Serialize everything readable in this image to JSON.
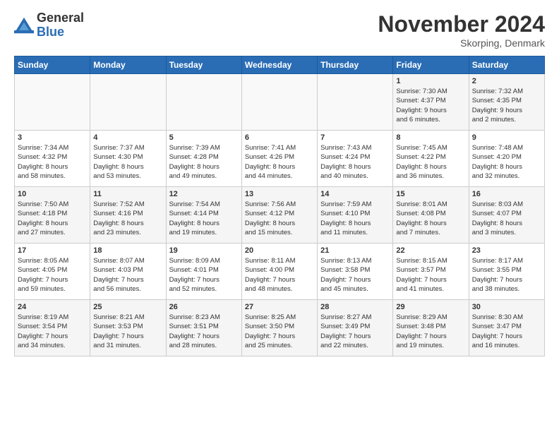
{
  "logo": {
    "line1": "General",
    "line2": "Blue"
  },
  "title": "November 2024",
  "location": "Skorping, Denmark",
  "days_of_week": [
    "Sunday",
    "Monday",
    "Tuesday",
    "Wednesday",
    "Thursday",
    "Friday",
    "Saturday"
  ],
  "weeks": [
    [
      {
        "day": "",
        "info": ""
      },
      {
        "day": "",
        "info": ""
      },
      {
        "day": "",
        "info": ""
      },
      {
        "day": "",
        "info": ""
      },
      {
        "day": "",
        "info": ""
      },
      {
        "day": "1",
        "info": "Sunrise: 7:30 AM\nSunset: 4:37 PM\nDaylight: 9 hours\nand 6 minutes."
      },
      {
        "day": "2",
        "info": "Sunrise: 7:32 AM\nSunset: 4:35 PM\nDaylight: 9 hours\nand 2 minutes."
      }
    ],
    [
      {
        "day": "3",
        "info": "Sunrise: 7:34 AM\nSunset: 4:32 PM\nDaylight: 8 hours\nand 58 minutes."
      },
      {
        "day": "4",
        "info": "Sunrise: 7:37 AM\nSunset: 4:30 PM\nDaylight: 8 hours\nand 53 minutes."
      },
      {
        "day": "5",
        "info": "Sunrise: 7:39 AM\nSunset: 4:28 PM\nDaylight: 8 hours\nand 49 minutes."
      },
      {
        "day": "6",
        "info": "Sunrise: 7:41 AM\nSunset: 4:26 PM\nDaylight: 8 hours\nand 44 minutes."
      },
      {
        "day": "7",
        "info": "Sunrise: 7:43 AM\nSunset: 4:24 PM\nDaylight: 8 hours\nand 40 minutes."
      },
      {
        "day": "8",
        "info": "Sunrise: 7:45 AM\nSunset: 4:22 PM\nDaylight: 8 hours\nand 36 minutes."
      },
      {
        "day": "9",
        "info": "Sunrise: 7:48 AM\nSunset: 4:20 PM\nDaylight: 8 hours\nand 32 minutes."
      }
    ],
    [
      {
        "day": "10",
        "info": "Sunrise: 7:50 AM\nSunset: 4:18 PM\nDaylight: 8 hours\nand 27 minutes."
      },
      {
        "day": "11",
        "info": "Sunrise: 7:52 AM\nSunset: 4:16 PM\nDaylight: 8 hours\nand 23 minutes."
      },
      {
        "day": "12",
        "info": "Sunrise: 7:54 AM\nSunset: 4:14 PM\nDaylight: 8 hours\nand 19 minutes."
      },
      {
        "day": "13",
        "info": "Sunrise: 7:56 AM\nSunset: 4:12 PM\nDaylight: 8 hours\nand 15 minutes."
      },
      {
        "day": "14",
        "info": "Sunrise: 7:59 AM\nSunset: 4:10 PM\nDaylight: 8 hours\nand 11 minutes."
      },
      {
        "day": "15",
        "info": "Sunrise: 8:01 AM\nSunset: 4:08 PM\nDaylight: 8 hours\nand 7 minutes."
      },
      {
        "day": "16",
        "info": "Sunrise: 8:03 AM\nSunset: 4:07 PM\nDaylight: 8 hours\nand 3 minutes."
      }
    ],
    [
      {
        "day": "17",
        "info": "Sunrise: 8:05 AM\nSunset: 4:05 PM\nDaylight: 7 hours\nand 59 minutes."
      },
      {
        "day": "18",
        "info": "Sunrise: 8:07 AM\nSunset: 4:03 PM\nDaylight: 7 hours\nand 56 minutes."
      },
      {
        "day": "19",
        "info": "Sunrise: 8:09 AM\nSunset: 4:01 PM\nDaylight: 7 hours\nand 52 minutes."
      },
      {
        "day": "20",
        "info": "Sunrise: 8:11 AM\nSunset: 4:00 PM\nDaylight: 7 hours\nand 48 minutes."
      },
      {
        "day": "21",
        "info": "Sunrise: 8:13 AM\nSunset: 3:58 PM\nDaylight: 7 hours\nand 45 minutes."
      },
      {
        "day": "22",
        "info": "Sunrise: 8:15 AM\nSunset: 3:57 PM\nDaylight: 7 hours\nand 41 minutes."
      },
      {
        "day": "23",
        "info": "Sunrise: 8:17 AM\nSunset: 3:55 PM\nDaylight: 7 hours\nand 38 minutes."
      }
    ],
    [
      {
        "day": "24",
        "info": "Sunrise: 8:19 AM\nSunset: 3:54 PM\nDaylight: 7 hours\nand 34 minutes."
      },
      {
        "day": "25",
        "info": "Sunrise: 8:21 AM\nSunset: 3:53 PM\nDaylight: 7 hours\nand 31 minutes."
      },
      {
        "day": "26",
        "info": "Sunrise: 8:23 AM\nSunset: 3:51 PM\nDaylight: 7 hours\nand 28 minutes."
      },
      {
        "day": "27",
        "info": "Sunrise: 8:25 AM\nSunset: 3:50 PM\nDaylight: 7 hours\nand 25 minutes."
      },
      {
        "day": "28",
        "info": "Sunrise: 8:27 AM\nSunset: 3:49 PM\nDaylight: 7 hours\nand 22 minutes."
      },
      {
        "day": "29",
        "info": "Sunrise: 8:29 AM\nSunset: 3:48 PM\nDaylight: 7 hours\nand 19 minutes."
      },
      {
        "day": "30",
        "info": "Sunrise: 8:30 AM\nSunset: 3:47 PM\nDaylight: 7 hours\nand 16 minutes."
      }
    ]
  ]
}
